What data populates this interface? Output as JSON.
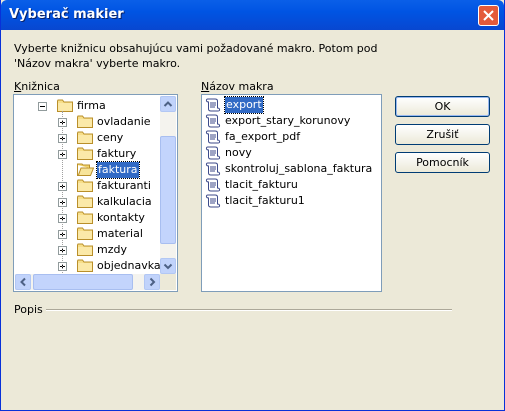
{
  "window": {
    "title": "Vyberač makier"
  },
  "intro": "Vyberte knižnicu obsahujúcu vami požadované makro. Potom pod 'Názov makra' vyberte makro.",
  "library": {
    "label_key": "K",
    "label_rest": "nižnica",
    "items": [
      {
        "label": "firma",
        "expanded": true,
        "level": 0
      },
      {
        "label": "ovladanie",
        "expanded": false,
        "level": 1
      },
      {
        "label": "ceny",
        "expanded": false,
        "level": 1
      },
      {
        "label": "faktury",
        "expanded": false,
        "level": 1
      },
      {
        "label": "faktura",
        "expanded": null,
        "level": 1,
        "selected": true
      },
      {
        "label": "fakturanti",
        "expanded": false,
        "level": 1
      },
      {
        "label": "kalkulacia",
        "expanded": false,
        "level": 1
      },
      {
        "label": "kontakty",
        "expanded": false,
        "level": 1
      },
      {
        "label": "material",
        "expanded": false,
        "level": 1
      },
      {
        "label": "mzdy",
        "expanded": false,
        "level": 1
      },
      {
        "label": "objednavka",
        "expanded": false,
        "level": 1
      }
    ]
  },
  "macros": {
    "label_key": "N",
    "label_rest": "ázov makra",
    "items": [
      "export",
      "export_stary_korunovy",
      "fa_export_pdf",
      "novy",
      "skontroluj_sablona_faktura",
      "tlacit_fakturu",
      "tlacit_fakturu1"
    ],
    "selected_index": 0
  },
  "buttons": {
    "ok": "OK",
    "cancel": "Zrušiť",
    "help": "Pomocník"
  },
  "description": {
    "label": "Popis"
  },
  "colors": {
    "title_bar": "#0054e3",
    "selection": "#316ac5",
    "dialog_bg": "#ece9d8"
  },
  "icons": {
    "folder": "folder-icon",
    "macro": "script-icon",
    "close": "close-icon"
  }
}
